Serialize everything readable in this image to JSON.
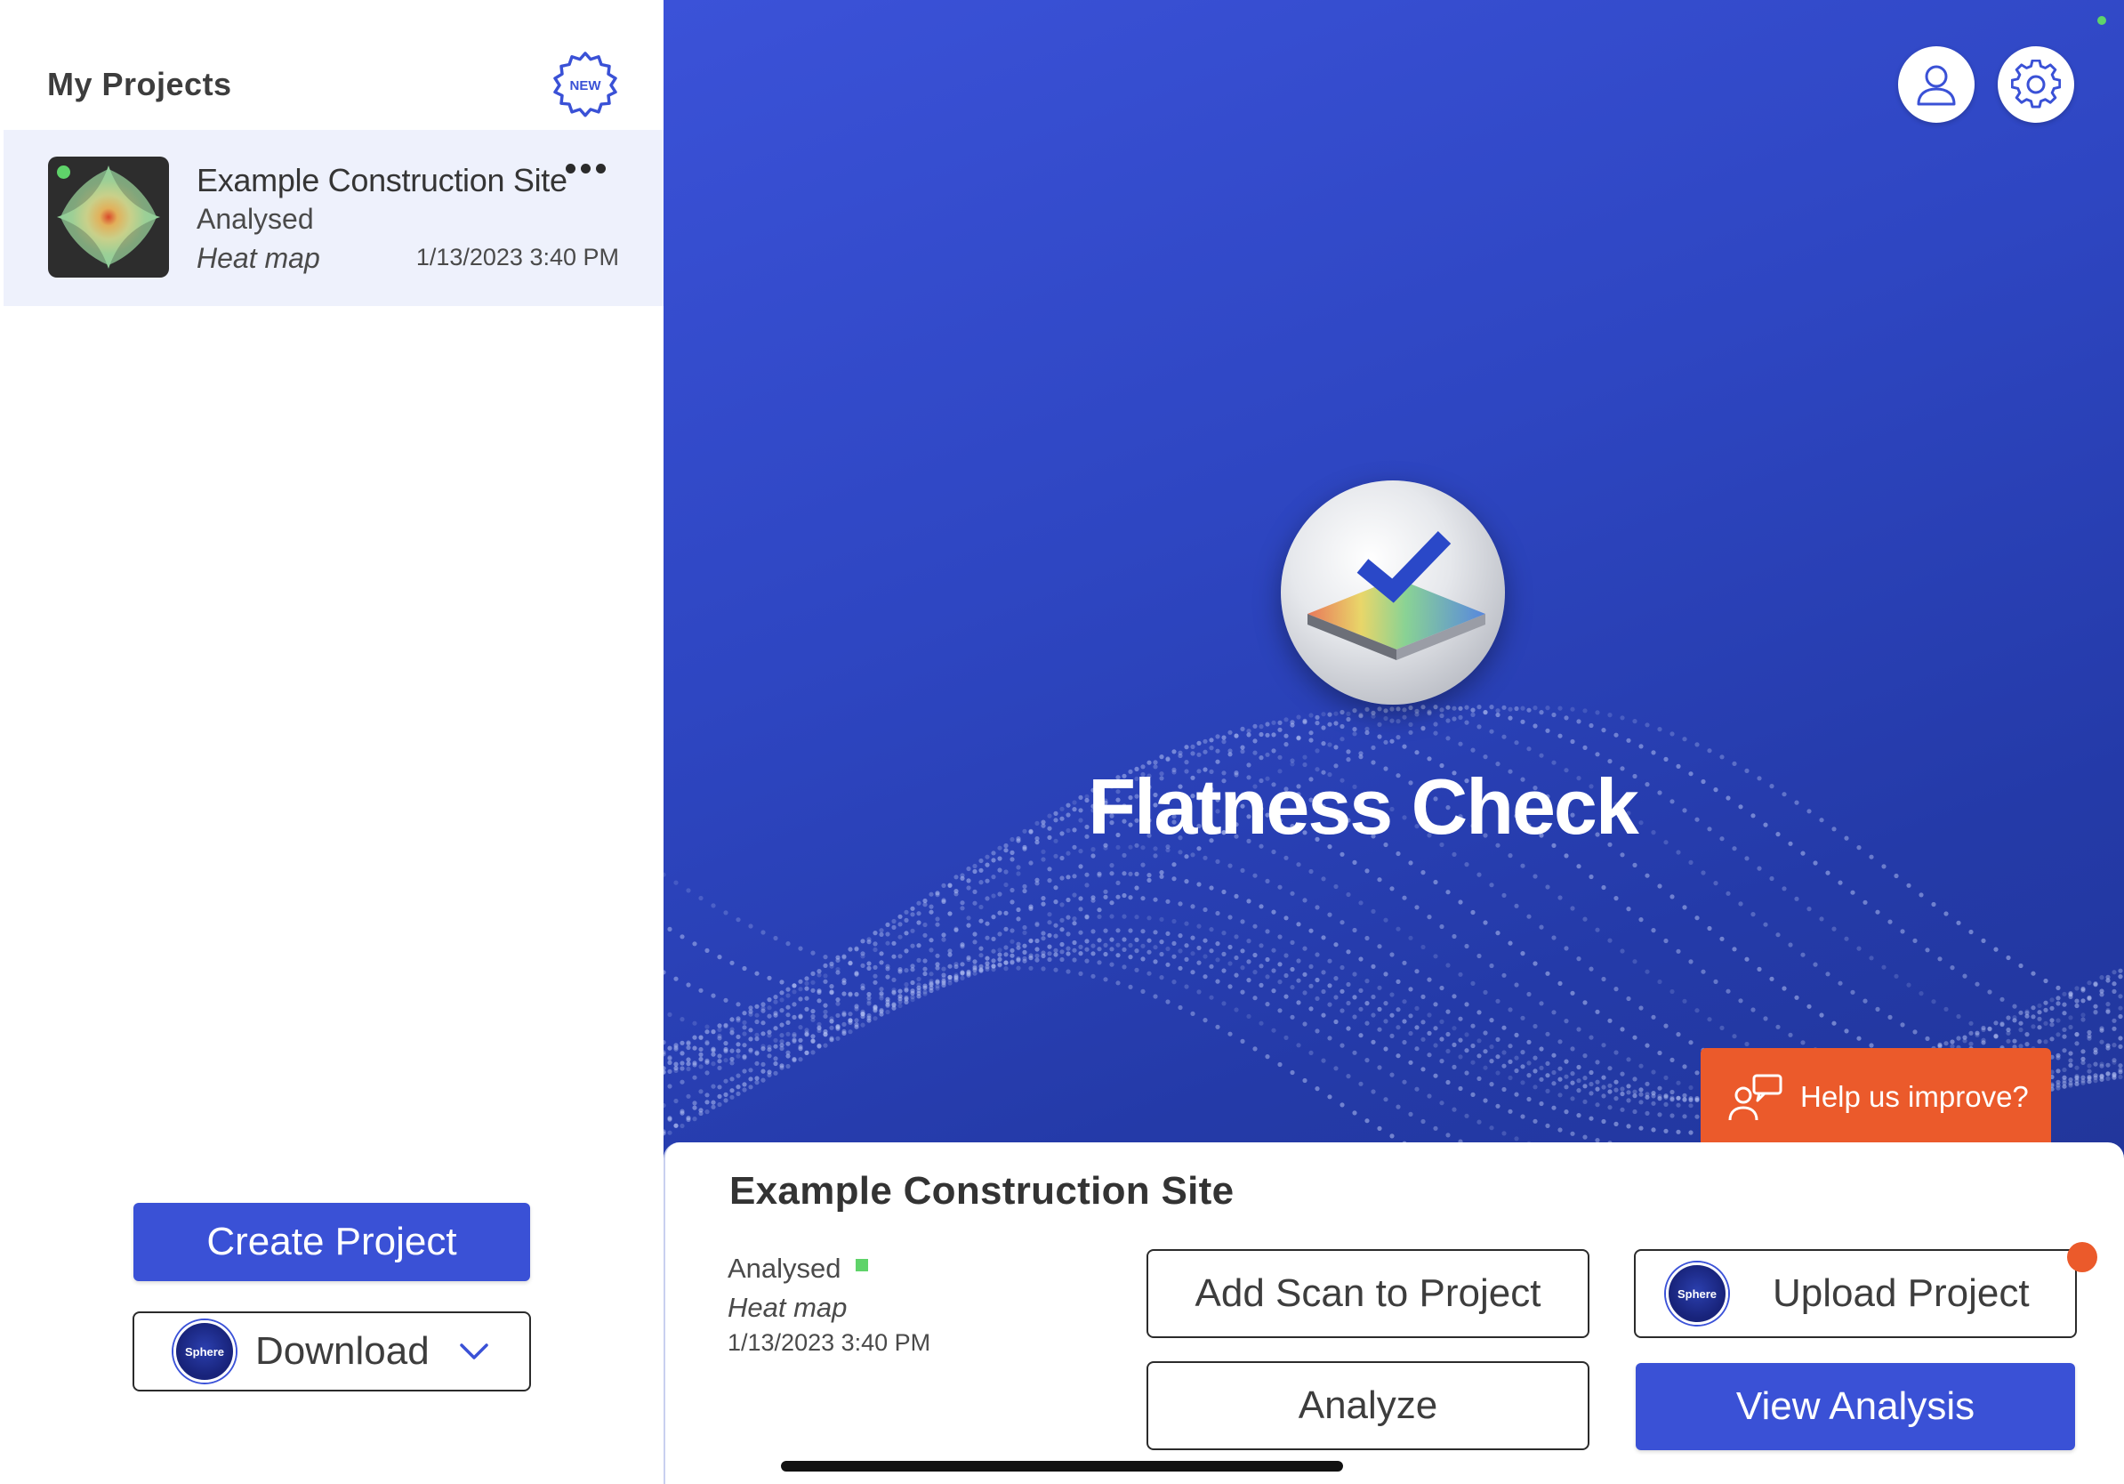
{
  "sidebar": {
    "title": "My Projects",
    "new_badge": "NEW",
    "projects": [
      {
        "name": "Example Construction Site",
        "status": "Analysed",
        "type": "Heat map",
        "date": "1/13/2023 3:40 PM",
        "status_color": "#5fd36a"
      }
    ],
    "create_label": "Create Project",
    "download_label": "Download",
    "sphere_logo_text": "Sphere"
  },
  "hero": {
    "app_title": "Flatness Check",
    "feedback_label": "Help us improve?"
  },
  "detail": {
    "title": "Example Construction Site",
    "status": "Analysed",
    "type": "Heat map",
    "date": "1/13/2023 3:40 PM",
    "add_scan_label": "Add Scan to Project",
    "upload_label": "Upload Project",
    "analyze_label": "Analyze",
    "view_label": "View Analysis"
  },
  "colors": {
    "accent": "#3a51d6",
    "feedback": "#eb5a2b",
    "status_green": "#5fd36a",
    "hero_bg": "#2e46c2"
  },
  "icons": {
    "new_badge": "new-badge-icon",
    "more": "more-options-icon",
    "profile": "user-icon",
    "settings": "gear-icon",
    "feedback": "feedback-people-icon",
    "download_chevron": "chevron-down-icon"
  }
}
